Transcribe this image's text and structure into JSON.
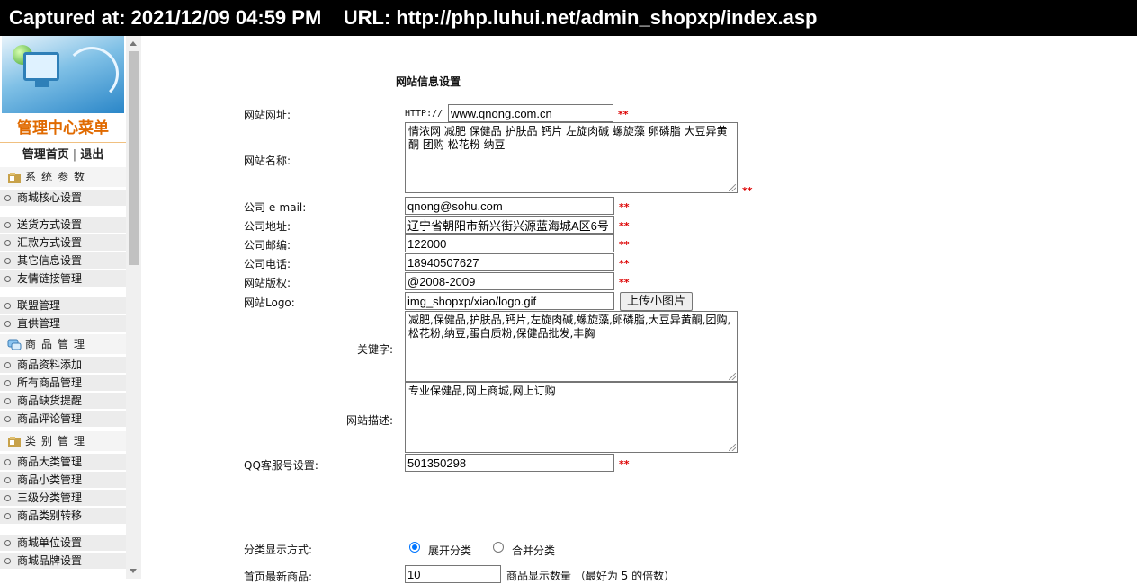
{
  "capture": {
    "timestamp_text": "Captured at: 2021/12/09 04:59 PM",
    "url_text": "URL: http://php.luhui.net/admin_shopxp/index.asp"
  },
  "sidebar": {
    "title": "管理中心菜单",
    "home_link": "管理首页",
    "separator": "|",
    "logout_link": "退出",
    "sections": [
      {
        "title": "系统参数",
        "items": [
          "商城核心设置",
          "送货方式设置",
          "汇款方式设置",
          "其它信息设置",
          "友情链接管理",
          "联盟管理",
          "直供管理"
        ]
      },
      {
        "title": "商品管理",
        "items": [
          "商品资料添加",
          "所有商品管理",
          "商品缺货提醒",
          "商品评论管理"
        ]
      },
      {
        "title": "类别管理",
        "items": [
          "商品大类管理",
          "商品小类管理",
          "三级分类管理",
          "商品类别转移",
          "商城单位设置",
          "商城品牌设置"
        ]
      }
    ]
  },
  "form": {
    "page_title": "网站信息设置",
    "required_mark": "**",
    "site_url": {
      "label": "网站网址:",
      "prefix": "HTTP://",
      "value": "www.qnong.com.cn"
    },
    "site_name": {
      "label": "网站名称:",
      "value": "情浓网 减肥 保健品 护肤品 钙片 左旋肉碱 螺旋藻 卵磷脂 大豆异黄酮 团购 松花粉 纳豆"
    },
    "email": {
      "label": "公司 e-mail:",
      "value": "qnong@sohu.com"
    },
    "address": {
      "label": "公司地址:",
      "value": "辽宁省朝阳市新兴街兴源蓝海城A区6号"
    },
    "postcode": {
      "label": "公司邮编:",
      "value": "122000"
    },
    "phone": {
      "label": "公司电话:",
      "value": "18940507627"
    },
    "copyright": {
      "label": "网站版权:",
      "value": "@2008-2009"
    },
    "logo": {
      "label": "网站Logo:",
      "value": "img_shopxp/xiao/logo.gif",
      "upload_button": "上传小图片"
    },
    "keywords": {
      "label": "关键字:",
      "value": "减肥,保健品,护肤品,钙片,左旋肉碱,螺旋藻,卵磷脂,大豆异黄酮,团购,松花粉,纳豆,蛋白质粉,保健品批发,丰胸"
    },
    "description": {
      "label": "网站描述:",
      "value": "专业保健品,网上商城,网上订购"
    },
    "qq": {
      "label": "QQ客服号设置:",
      "value": "501350298"
    },
    "category_display": {
      "label": "分类显示方式:",
      "options": [
        "展开分类",
        "合并分类"
      ],
      "selected": "展开分类"
    },
    "new_products": {
      "label": "首页最新商品:",
      "value": "10",
      "hint": "商品显示数量 （最好为 5 的倍数）"
    }
  }
}
